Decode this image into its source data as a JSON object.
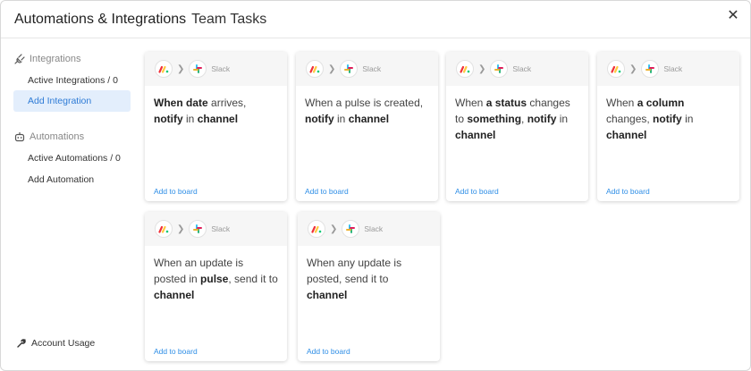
{
  "header": {
    "title": "Automations & Integrations",
    "board_name": "Team Tasks"
  },
  "sidebar": {
    "integrations_heading": "Integrations",
    "active_integrations": "Active Integrations / 0",
    "add_integration": "Add Integration",
    "automations_heading": "Automations",
    "active_automations": "Active Automations / 0",
    "add_automation": "Add Automation",
    "account_usage": "Account Usage"
  },
  "cards": [
    {
      "service": "Slack",
      "parts": [
        [
          "When",
          "b"
        ],
        [
          "date",
          "b"
        ],
        [
          "arrives,",
          ""
        ],
        [
          "notify",
          "b"
        ],
        [
          "in",
          ""
        ],
        [
          "channel",
          "b"
        ]
      ],
      "link": "Add to board"
    },
    {
      "service": "Slack",
      "parts": [
        [
          "When a pulse is created,",
          ""
        ],
        [
          "notify",
          "b"
        ],
        [
          "in",
          ""
        ],
        [
          "channel",
          "b"
        ]
      ],
      "link": "Add to board"
    },
    {
      "service": "Slack",
      "parts": [
        [
          "When",
          ""
        ],
        [
          "a status",
          "b"
        ],
        [
          "changes to",
          ""
        ],
        [
          "something",
          "b"
        ],
        [
          ",",
          ""
        ],
        [
          "notify",
          "b"
        ],
        [
          "in",
          ""
        ],
        [
          "channel",
          "b"
        ]
      ],
      "link": "Add to board"
    },
    {
      "service": "Slack",
      "parts": [
        [
          "When",
          ""
        ],
        [
          "a column",
          "b"
        ],
        [
          "changes,",
          ""
        ],
        [
          "notify",
          "b"
        ],
        [
          "in",
          ""
        ],
        [
          "channel",
          "b"
        ]
      ],
      "link": "Add to board"
    },
    {
      "service": "Slack",
      "parts": [
        [
          "When an update is posted in",
          ""
        ],
        [
          "pulse",
          "b"
        ],
        [
          ", send it to",
          ""
        ],
        [
          "channel",
          "b"
        ]
      ],
      "link": "Add to board"
    },
    {
      "service": "Slack",
      "parts": [
        [
          "When any update is posted, send it to",
          ""
        ],
        [
          "channel",
          "b"
        ]
      ],
      "link": "Add to board"
    }
  ],
  "colors": {
    "accent": "#2e8ee6",
    "active_nav_bg": "#e3eefc"
  },
  "icons": [
    "plug-icon",
    "robot-icon",
    "wrench-icon",
    "close-icon",
    "monday-logo-icon",
    "slack-logo-icon",
    "chevron-right-icon"
  ]
}
